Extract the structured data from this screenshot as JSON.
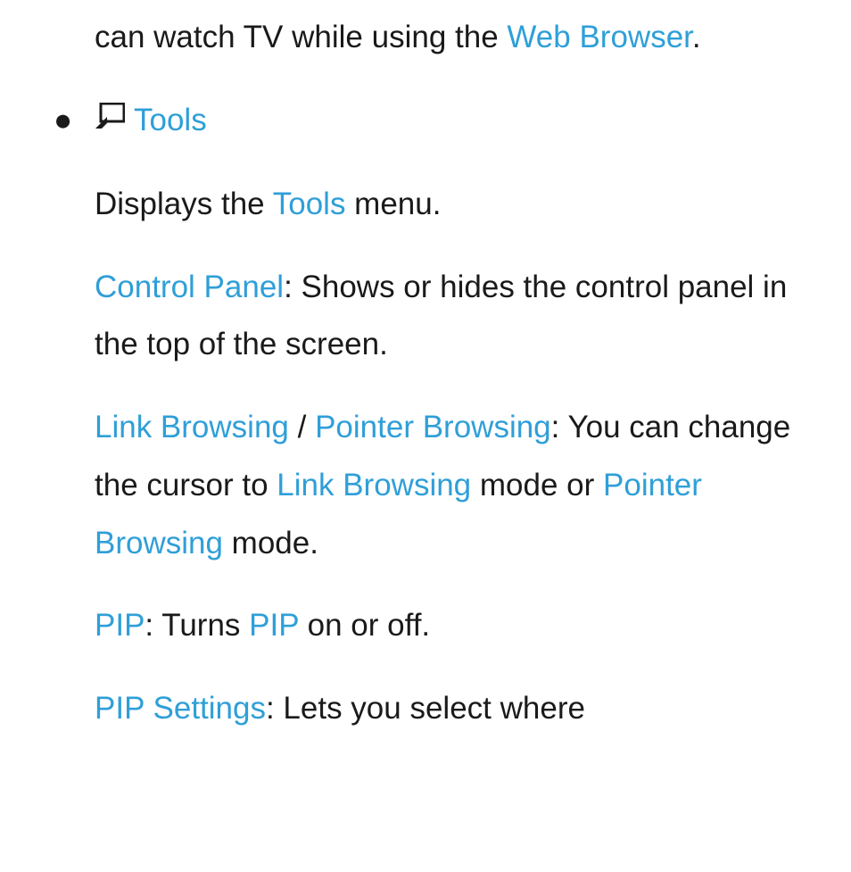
{
  "intro": {
    "pre": "can watch TV while using the ",
    "link": "Web Browser",
    "post": "."
  },
  "bulletHeading": {
    "label": "Tools"
  },
  "paragraphs": {
    "p1": {
      "t1": "Displays the ",
      "h1": "Tools",
      "t2": " menu."
    },
    "p2": {
      "h1": "Control Panel",
      "t1": ": Shows or hides the control panel in the top of the screen."
    },
    "p3": {
      "h1": "Link Browsing",
      "sep": " / ",
      "h2": "Pointer Browsing",
      "t1": ": You can change the cursor to ",
      "h3": "Link Browsing",
      "t2": " mode or ",
      "h4": "Pointer Browsing",
      "t3": " mode."
    },
    "p4": {
      "h1": "PIP",
      "t1": ": Turns ",
      "h2": "PIP",
      "t2": " on or off."
    },
    "p5": {
      "h1": "PIP Settings",
      "t1": ": Lets you select where"
    }
  }
}
